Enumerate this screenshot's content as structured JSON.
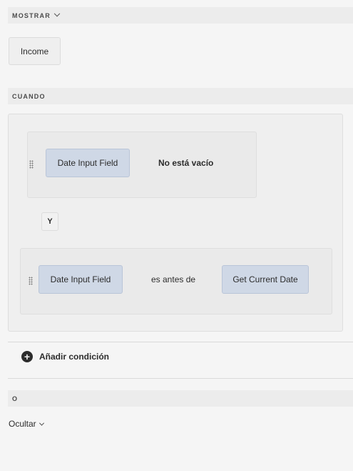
{
  "show_section": {
    "title": "MOSTRAR",
    "item": "Income"
  },
  "when_section": {
    "title": "CUANDO",
    "condition1": {
      "field": "Date Input Field",
      "operator": "No está vacío"
    },
    "connector": "Y",
    "condition2": {
      "field": "Date Input Field",
      "operator": "es antes de",
      "value": "Get Current Date"
    },
    "add_condition_label": "Añadir condición"
  },
  "else_section": {
    "title": "O",
    "action": "Ocultar"
  }
}
